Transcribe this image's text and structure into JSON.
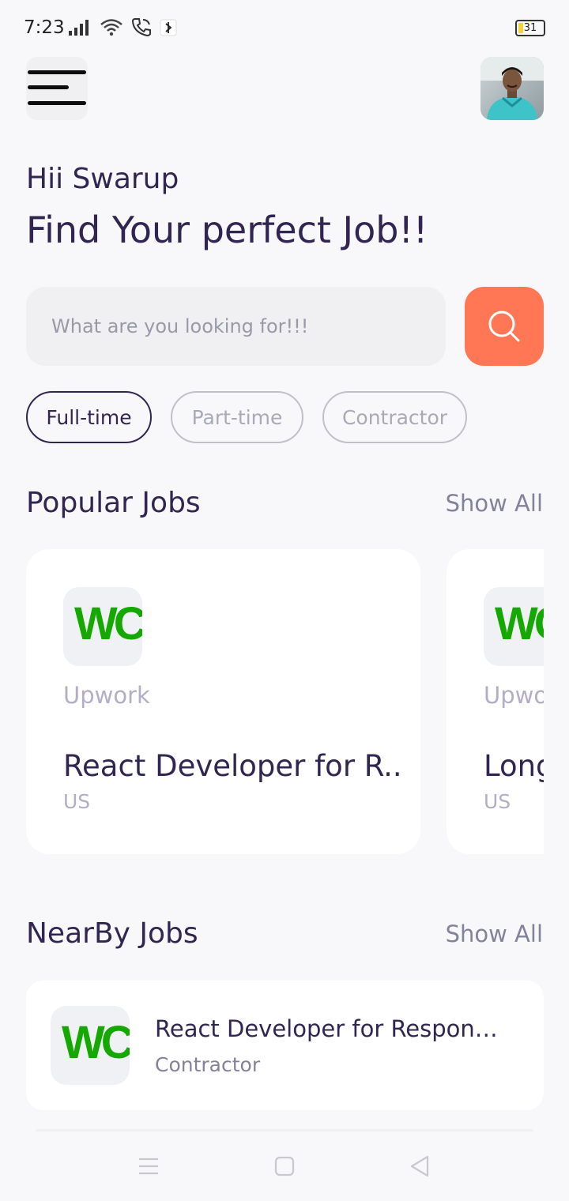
{
  "status_bar": {
    "time": "7:23",
    "battery": "31"
  },
  "header": {
    "greeting": "Hii Swarup",
    "headline": "Find Your perfect Job!!"
  },
  "search": {
    "placeholder": "What are you looking for!!!"
  },
  "job_types": [
    {
      "label": "Full-time",
      "active": true
    },
    {
      "label": "Part-time",
      "active": false
    },
    {
      "label": "Contractor",
      "active": false
    }
  ],
  "popular": {
    "title": "Popular Jobs",
    "show_all": "Show All",
    "cards": [
      {
        "company": "Upwork",
        "title": "React Developer for R..",
        "country": "US",
        "logo": "WC"
      },
      {
        "company": "Upwo",
        "title": "Long",
        "country": "US",
        "logo": "WC"
      }
    ]
  },
  "nearby": {
    "title": "NearBy Jobs",
    "show_all": "Show All",
    "items": [
      {
        "title": "React Developer for Respon…",
        "type": "Contractor",
        "logo": "WC"
      }
    ]
  },
  "colors": {
    "accent": "#FF7754",
    "primary": "#312651",
    "upwork_green": "#14A800",
    "background": "#F8F8FB"
  },
  "icons": [
    "menu-icon",
    "search-icon",
    "nav-recents-icon",
    "nav-home-icon",
    "nav-back-icon"
  ]
}
